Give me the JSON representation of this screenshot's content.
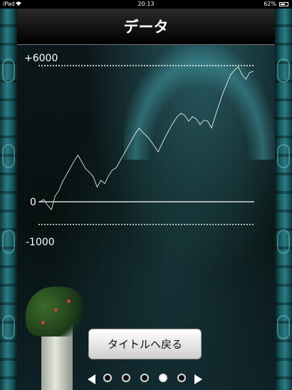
{
  "status_bar": {
    "carrier": "iPad",
    "time": "20:13",
    "battery_text": "62%",
    "battery_level": 0.62
  },
  "title": "データ",
  "chart_data": {
    "type": "line",
    "y_tick_labels": [
      "+6000",
      "0",
      "-1000"
    ],
    "ylim": [
      -1000,
      6000
    ],
    "reference_lines": [
      {
        "value": 6000,
        "style": "dotted"
      },
      {
        "value": 0,
        "style": "solid"
      },
      {
        "value": -1000,
        "style": "dotted"
      }
    ],
    "line_color": "#ffffff",
    "y": [
      0,
      100,
      -150,
      -350,
      250,
      500,
      900,
      1200,
      1500,
      1800,
      2050,
      1750,
      1450,
      1300,
      1100,
      650,
      950,
      800,
      1150,
      1400,
      1500,
      1800,
      2100,
      2400,
      2700,
      3000,
      3250,
      3050,
      2900,
      2700,
      2450,
      2200,
      2550,
      2900,
      3200,
      3500,
      3750,
      3900,
      3800,
      3550,
      3750,
      3650,
      3400,
      3600,
      3550,
      3250,
      3800,
      4300,
      4800,
      5200,
      5600,
      5800,
      5950,
      5600,
      5400,
      5700,
      5750
    ]
  },
  "buttons": {
    "back_to_title": "タイトルへ戻る"
  },
  "pager": {
    "pages": 5,
    "current": 4
  },
  "colors": {
    "accent": "#ffffff",
    "background": "#0b1418"
  }
}
